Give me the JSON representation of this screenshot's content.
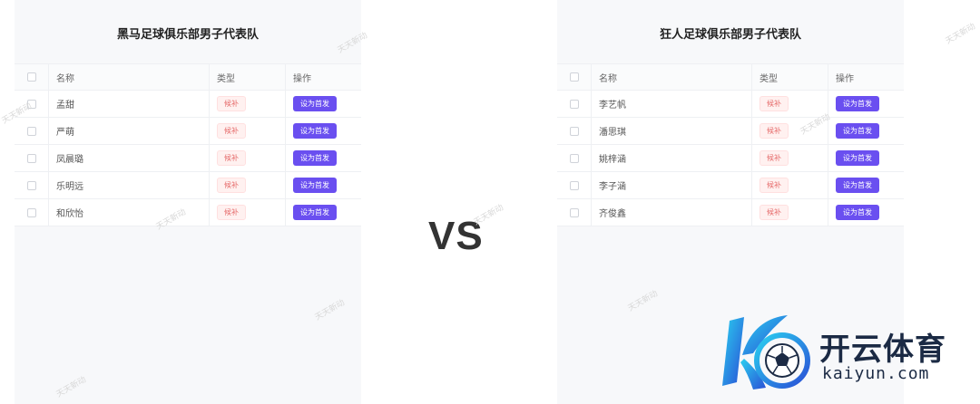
{
  "watermark_text": "天天新动",
  "vs_label": "VS",
  "columns": {
    "name": "名称",
    "type": "类型",
    "action": "操作"
  },
  "left_team": {
    "title": "黑马足球俱乐部男子代表队",
    "rows": [
      {
        "name": "孟甜",
        "type": "候补",
        "action": "设为首发"
      },
      {
        "name": "严萌",
        "type": "候补",
        "action": "设为首发"
      },
      {
        "name": "凤晨璐",
        "type": "候补",
        "action": "设为首发"
      },
      {
        "name": "乐明远",
        "type": "候补",
        "action": "设为首发"
      },
      {
        "name": "和欣怡",
        "type": "候补",
        "action": "设为首发"
      }
    ]
  },
  "right_team": {
    "title": "狂人足球俱乐部男子代表队",
    "rows": [
      {
        "name": "李艺帆",
        "type": "候补",
        "action": "设为首发"
      },
      {
        "name": "潘思琪",
        "type": "候补",
        "action": "设为首发"
      },
      {
        "name": "姚梓涵",
        "type": "候补",
        "action": "设为首发"
      },
      {
        "name": "李子涵",
        "type": "候补",
        "action": "设为首发"
      },
      {
        "name": "齐俊鑫",
        "type": "候补",
        "action": "设为首发"
      }
    ]
  },
  "logo": {
    "brand": "开云体育",
    "url": "kaiyun.com",
    "colors": {
      "primary": "#1aa0e8",
      "dark": "#1b2a44",
      "accent": "#2a6fd6"
    }
  },
  "colors": {
    "button": "#6a4ff0",
    "tag_text": "#e66b6b",
    "tag_bg": "#fff1f0",
    "panel_bg": "#f7f8fa"
  }
}
